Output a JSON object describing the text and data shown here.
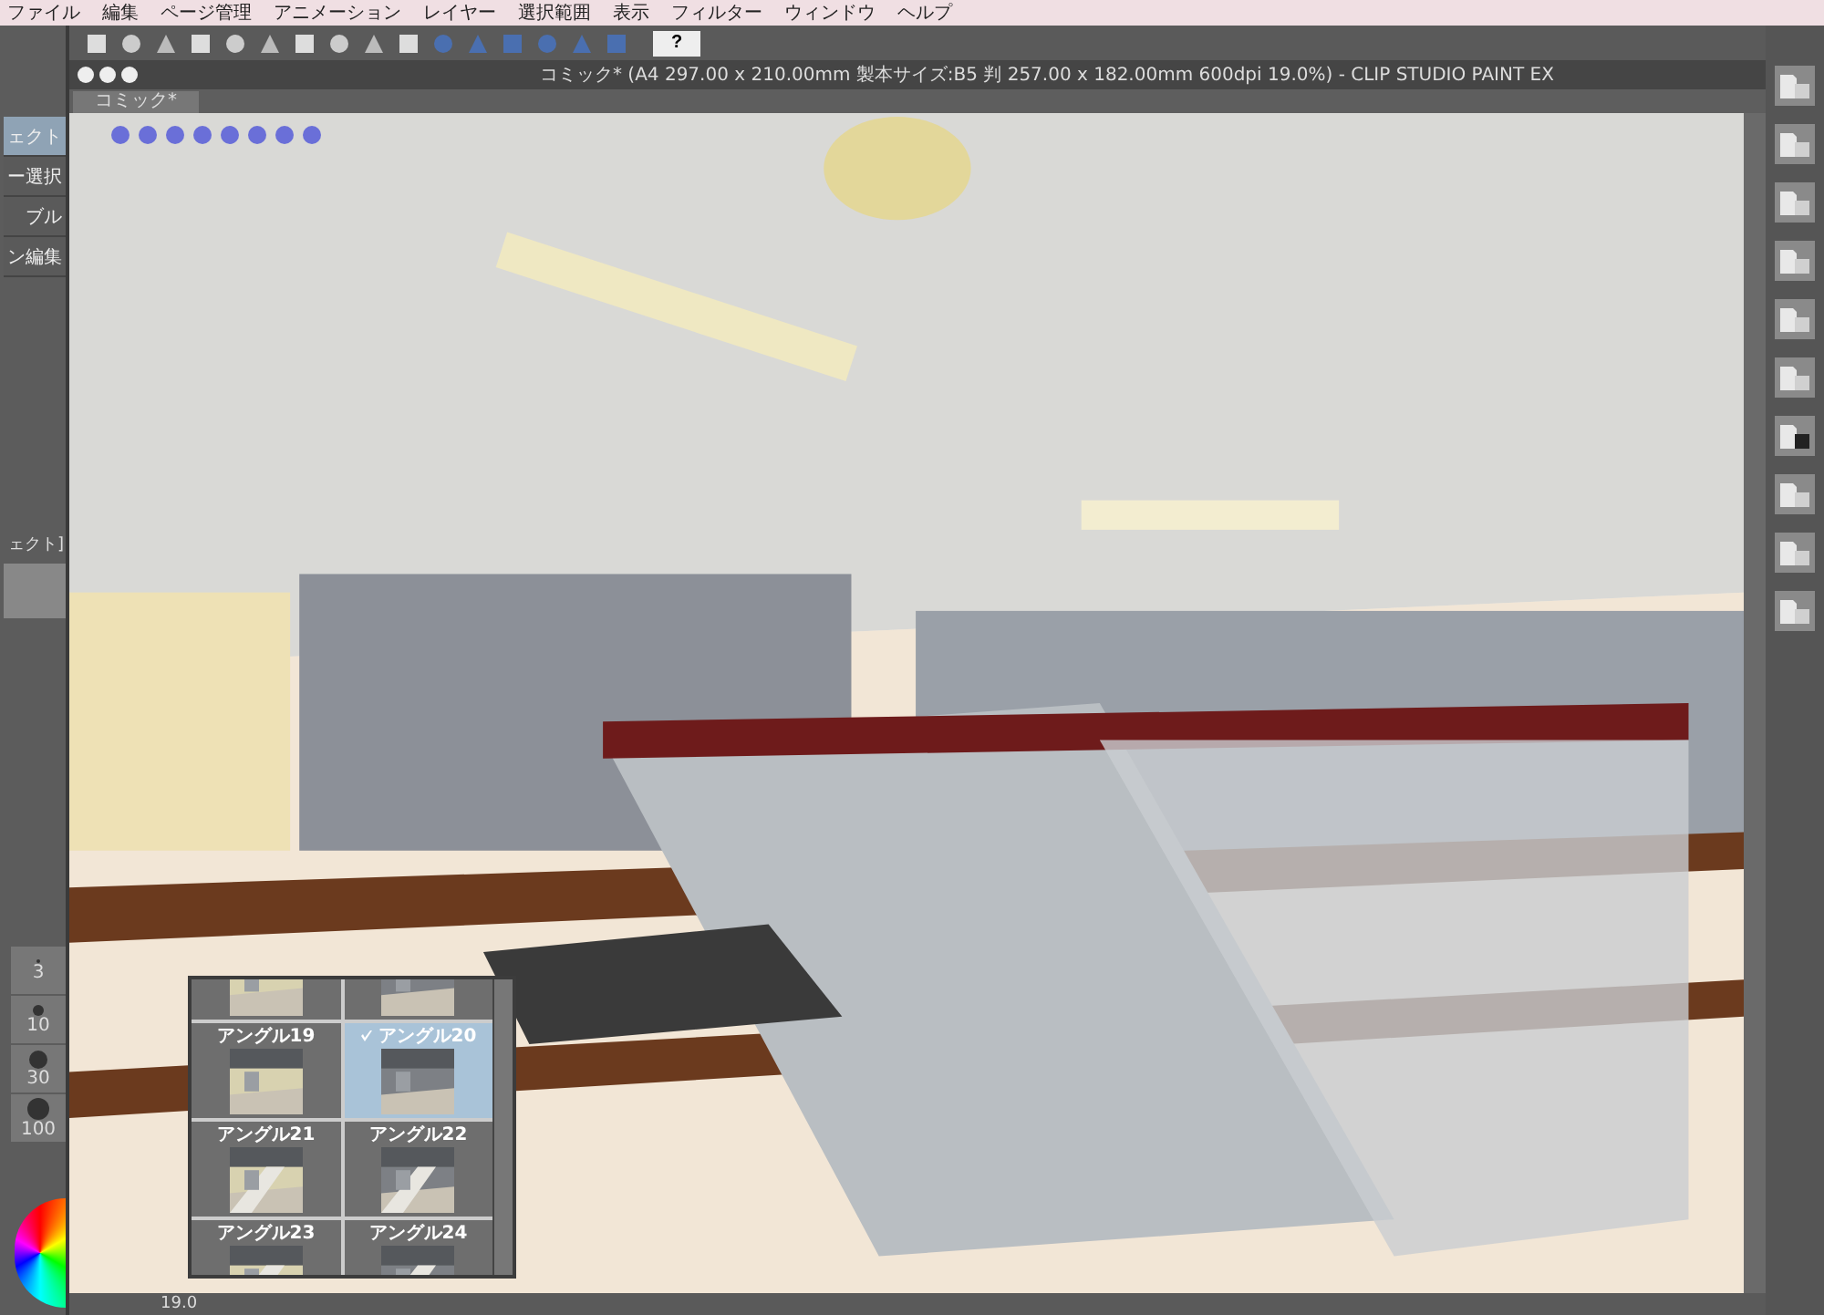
{
  "menu": [
    "ファイル",
    "編集",
    "ページ管理",
    "アニメーション",
    "レイヤー",
    "選択範囲",
    "表示",
    "フィルター",
    "ウィンドウ",
    "ヘルプ"
  ],
  "toolbar": {
    "help": "?"
  },
  "document": {
    "title": "コミック* (A4 297.00 x 210.00mm 製本サイズ:B5 判 257.00 x 182.00mm 600dpi 19.0%)  - CLIP STUDIO PAINT EX",
    "tab": "コミック*"
  },
  "left_panel": {
    "items": [
      {
        "label": "ェクト",
        "selected": true
      },
      {
        "label": "ー選択",
        "selected": false
      },
      {
        "label": "ブル",
        "selected": false
      },
      {
        "label": "ン編集",
        "selected": false
      }
    ],
    "layer_label": "ェクト]",
    "brush_sizes": [
      "3",
      "10",
      "30",
      "100"
    ]
  },
  "canvas": {
    "zoom": "19.0"
  },
  "angles": [
    {
      "selected": false
    },
    {
      "selected": false
    },
    {
      "label": "アングル19",
      "selected": false
    },
    {
      "label": "アングル20",
      "selected": true
    },
    {
      "label": "アングル21",
      "selected": false
    },
    {
      "label": "アングル22",
      "selected": false
    },
    {
      "label": "アングル23",
      "selected": false
    },
    {
      "label": "アングル24",
      "selected": false
    }
  ]
}
